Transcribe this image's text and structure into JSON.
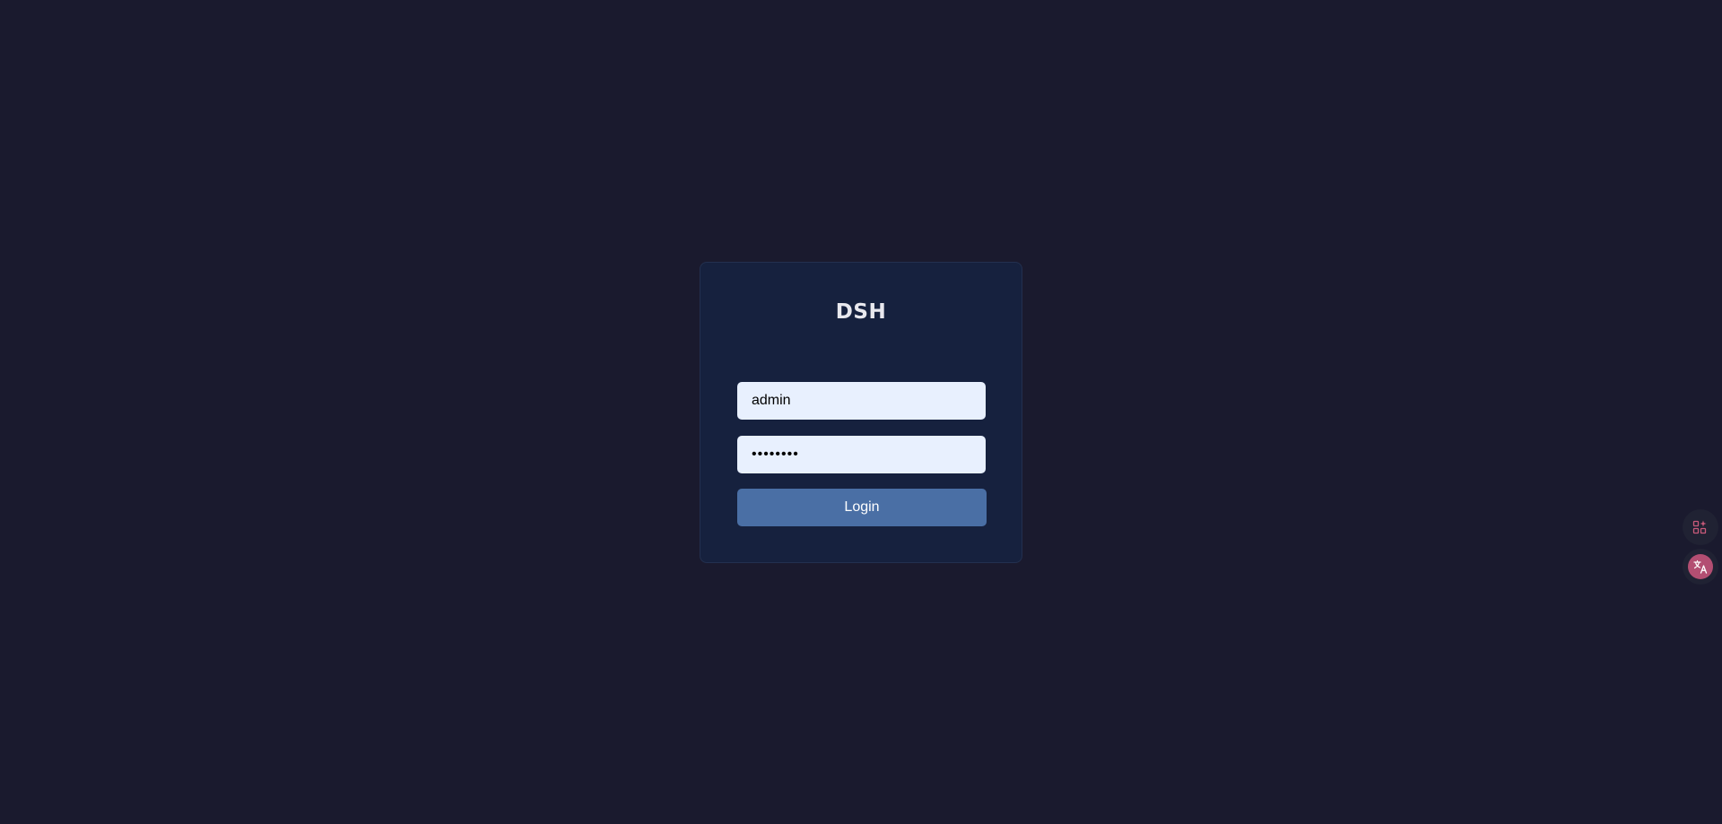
{
  "colors": {
    "page_background": "#1a1a2e",
    "card_background": "#16213e",
    "input_background": "#e8f0fe",
    "button_background": "#4a6fa5",
    "title_color": "#e8e8ee",
    "side_icon_accent": "#c85a7a"
  },
  "login": {
    "title": "DSH",
    "username": {
      "value": "admin",
      "placeholder": ""
    },
    "password": {
      "value": "••••••••"
    },
    "button_label": "Login"
  },
  "side_tools": {
    "icons": [
      "apps-sparkle-icon",
      "translate-icon"
    ]
  }
}
